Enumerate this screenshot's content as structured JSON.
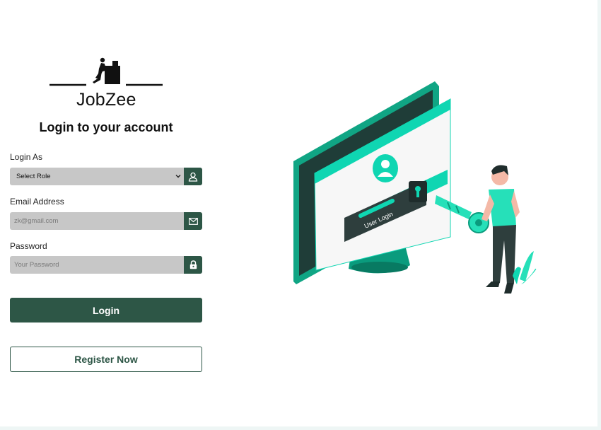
{
  "brand": {
    "name": "JobZee"
  },
  "form": {
    "heading": "Login to your account",
    "role": {
      "label": "Login As",
      "selected": "Select Role",
      "icon": "user-icon"
    },
    "email": {
      "label": "Email Address",
      "placeholder": "zk@gmail.com",
      "value": "",
      "icon": "envelope-icon"
    },
    "password": {
      "label": "Password",
      "placeholder": "Your Password",
      "value": "",
      "icon": "lock-icon"
    },
    "login_label": "Login",
    "register_label": "Register Now"
  },
  "illustration": {
    "screen_text": "User Login"
  },
  "colors": {
    "primary": "#2d5646",
    "accent": "#0fd6b2",
    "field_bg": "#c7c7c7"
  }
}
